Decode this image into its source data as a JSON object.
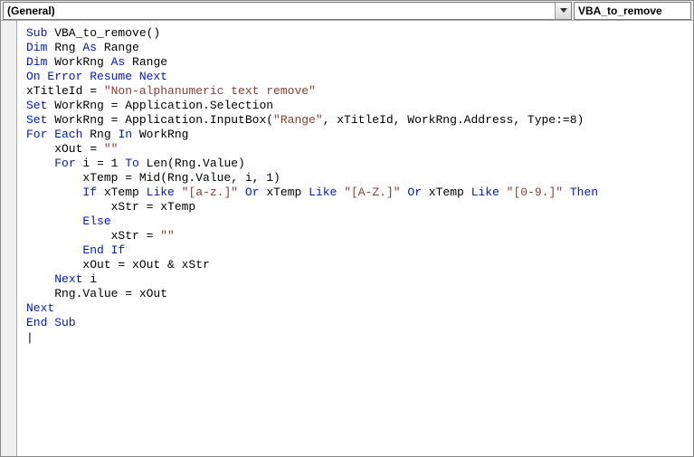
{
  "toolbar": {
    "left_dropdown": "(General)",
    "right_dropdown": "VBA_to_remove"
  },
  "code": {
    "tokens": [
      [
        {
          "t": "Sub",
          "c": "kw"
        },
        {
          "t": " VBA_to_remove()"
        }
      ],
      [
        {
          "t": "Dim",
          "c": "kw"
        },
        {
          "t": " Rng "
        },
        {
          "t": "As",
          "c": "kw"
        },
        {
          "t": " Range"
        }
      ],
      [
        {
          "t": "Dim",
          "c": "kw"
        },
        {
          "t": " WorkRng "
        },
        {
          "t": "As",
          "c": "kw"
        },
        {
          "t": " Range"
        }
      ],
      [
        {
          "t": "On Error Resume Next",
          "c": "kw"
        }
      ],
      [
        {
          "t": "xTitleId = "
        },
        {
          "t": "\"Non-alphanumeric text remove\"",
          "c": "str"
        }
      ],
      [
        {
          "t": "Set",
          "c": "kw"
        },
        {
          "t": " WorkRng = Application.Selection"
        }
      ],
      [
        {
          "t": "Set",
          "c": "kw"
        },
        {
          "t": " WorkRng = Application.InputBox("
        },
        {
          "t": "\"Range\"",
          "c": "str"
        },
        {
          "t": ", xTitleId, WorkRng.Address, Type:=8)"
        }
      ],
      [
        {
          "t": "For Each",
          "c": "kw"
        },
        {
          "t": " Rng "
        },
        {
          "t": "In",
          "c": "kw"
        },
        {
          "t": " WorkRng"
        }
      ],
      [
        {
          "t": "    xOut = "
        },
        {
          "t": "\"\"",
          "c": "str"
        }
      ],
      [
        {
          "t": "    "
        },
        {
          "t": "For",
          "c": "kw"
        },
        {
          "t": " i = 1 "
        },
        {
          "t": "To",
          "c": "kw"
        },
        {
          "t": " Len(Rng.Value)"
        }
      ],
      [
        {
          "t": "        xTemp = Mid(Rng.Value, i, 1)"
        }
      ],
      [
        {
          "t": "        "
        },
        {
          "t": "If",
          "c": "kw"
        },
        {
          "t": " xTemp "
        },
        {
          "t": "Like",
          "c": "kw"
        },
        {
          "t": " "
        },
        {
          "t": "\"[a-z.]\"",
          "c": "str"
        },
        {
          "t": " "
        },
        {
          "t": "Or",
          "c": "kw"
        },
        {
          "t": " xTemp "
        },
        {
          "t": "Like",
          "c": "kw"
        },
        {
          "t": " "
        },
        {
          "t": "\"[A-Z.]\"",
          "c": "str"
        },
        {
          "t": " "
        },
        {
          "t": "Or",
          "c": "kw"
        },
        {
          "t": " xTemp "
        },
        {
          "t": "Like",
          "c": "kw"
        },
        {
          "t": " "
        },
        {
          "t": "\"[0-9.]\"",
          "c": "str"
        },
        {
          "t": " "
        },
        {
          "t": "Then",
          "c": "kw"
        }
      ],
      [
        {
          "t": "            xStr = xTemp"
        }
      ],
      [
        {
          "t": "        "
        },
        {
          "t": "Else",
          "c": "kw"
        }
      ],
      [
        {
          "t": "            xStr = "
        },
        {
          "t": "\"\"",
          "c": "str"
        }
      ],
      [
        {
          "t": "        "
        },
        {
          "t": "End If",
          "c": "kw"
        }
      ],
      [
        {
          "t": "        xOut = xOut & xStr"
        }
      ],
      [
        {
          "t": "    "
        },
        {
          "t": "Next",
          "c": "kw"
        },
        {
          "t": " i"
        }
      ],
      [
        {
          "t": "    Rng.Value = xOut"
        }
      ],
      [
        {
          "t": "Next",
          "c": "kw"
        }
      ],
      [
        {
          "t": "End Sub",
          "c": "kw"
        }
      ]
    ]
  }
}
